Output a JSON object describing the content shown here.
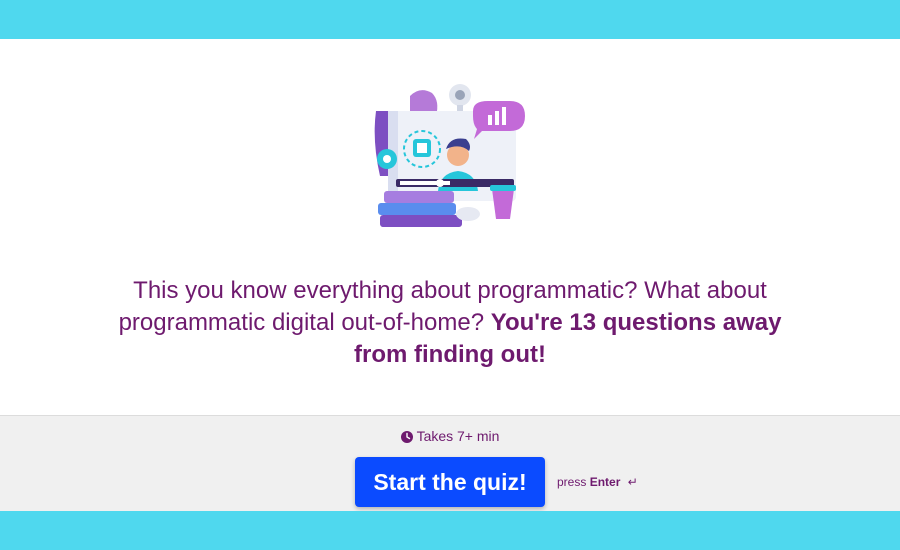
{
  "colors": {
    "band": "#4fd8ee",
    "text_purple": "#6e1a6e",
    "button_blue": "#0b4bff",
    "footer_bg": "#f0f0f0"
  },
  "illustration": {
    "icon_name": "online-learning-illustration"
  },
  "headline": {
    "text_regular": "This you know everything about programmatic? What about programmatic digital out-of-home? ",
    "text_bold": "You're 13 questions away from finding out!"
  },
  "footer": {
    "duration_icon": "clock-icon",
    "duration_text": "Takes 7+ min",
    "start_button_label": "Start the quiz!",
    "press_prefix": "press",
    "press_key": "Enter",
    "enter_icon": "↵"
  }
}
